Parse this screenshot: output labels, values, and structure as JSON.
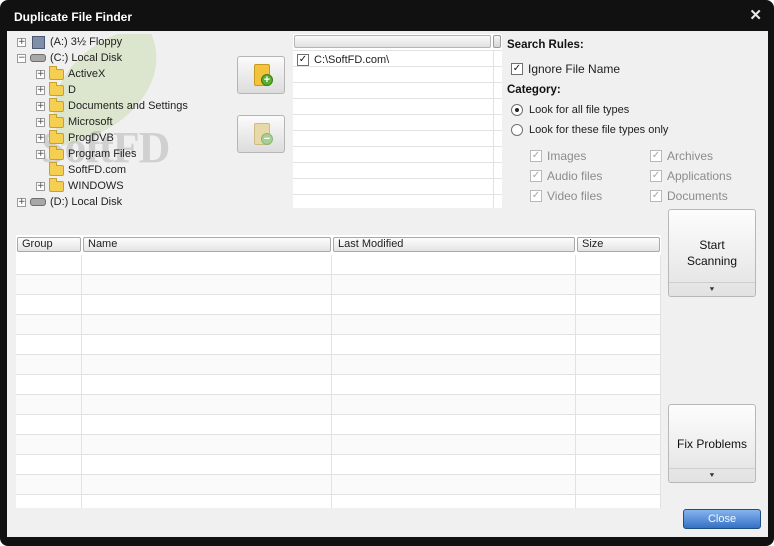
{
  "window": {
    "title": "Duplicate File Finder"
  },
  "tree": {
    "watermark": "SoftFD",
    "items": [
      {
        "label": "(A:) 3½ Floppy"
      },
      {
        "label": "(C:) Local Disk"
      },
      {
        "label": "ActiveX"
      },
      {
        "label": "D"
      },
      {
        "label": "Documents and Settings"
      },
      {
        "label": "Microsoft"
      },
      {
        "label": "ProgDVB"
      },
      {
        "label": "Program Files"
      },
      {
        "label": "SoftFD.com"
      },
      {
        "label": "WINDOWS"
      },
      {
        "label": "(D:) Local Disk"
      }
    ]
  },
  "folder_list": {
    "entries": [
      {
        "path": "C:\\SoftFD.com\\",
        "checked": true
      }
    ]
  },
  "rules": {
    "search_rules_heading": "Search Rules:",
    "ignore_file_name": "Ignore File Name",
    "category_heading": "Category:",
    "look_all": "Look for all file types",
    "look_these": "Look for these file types only",
    "types": {
      "images": "Images",
      "archives": "Archives",
      "audio": "Audio files",
      "applications": "Applications",
      "video": "Video files",
      "documents": "Documents"
    }
  },
  "results": {
    "columns": [
      "Group",
      "Name",
      "Last Modified",
      "Size"
    ]
  },
  "buttons": {
    "start_line1": "Start",
    "start_line2": "Scanning",
    "fix_problems": "Fix Problems",
    "close": "Close",
    "dropdown_glyph": "⯆"
  },
  "colors": {
    "frame": "#111111",
    "client": "#f0f0f0",
    "accent_blue": "#3571c4",
    "folder_yellow": "#f4cf52",
    "badge_green": "#5aae2e"
  }
}
